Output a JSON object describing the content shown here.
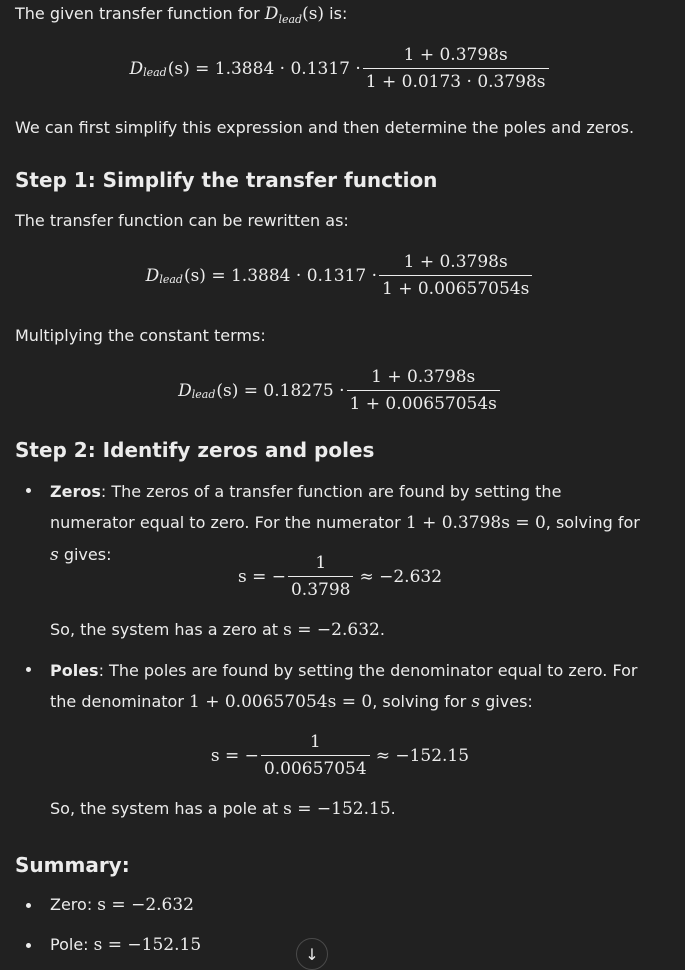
{
  "intro": {
    "text_before": "The given transfer function for ",
    "text_after": " is:",
    "D": "D",
    "sub": "lead",
    "arg": "(s)"
  },
  "eq1": {
    "lhs_D": "D",
    "lhs_sub": "lead",
    "lhs_arg": "(s) = 1.3884 · 0.1317 ·",
    "num": "1 + 0.3798s",
    "den": "1 + 0.0173 · 0.3798s"
  },
  "simplify_text": "We can first simplify this expression and then determine the poles and zeros.",
  "step1": {
    "heading": "Step 1: Simplify the transfer function",
    "text": "The transfer function can be rewritten as:",
    "eq_lhs_arg": "(s) = 1.3884 · 0.1317 ·",
    "eq_num": "1 + 0.3798s",
    "eq_den": "1 + 0.00657054s",
    "multiply_text": "Multiplying the constant terms:",
    "eq2_lhs_arg": "(s) = 0.18275 ·",
    "eq2_num": "1 + 0.3798s",
    "eq2_den": "1 + 0.00657054s"
  },
  "step2": {
    "heading": "Step 2: Identify zeros and poles",
    "zeros": {
      "label": "Zeros",
      "text1": ": The zeros of a transfer function are found by setting the numerator equal to zero. For the numerator ",
      "math1": "1 + 0.3798s = 0",
      "text2": ", solving for ",
      "s": "s",
      "text3": " gives:",
      "eq_lhs": "s = −",
      "eq_num": "1",
      "eq_den": "0.3798",
      "eq_rhs": "≈ −2.632",
      "conclusion_text": "So, the system has a zero at ",
      "conclusion_math": "s = −2.632",
      "conclusion_end": "."
    },
    "poles": {
      "label": "Poles",
      "text1": ": The poles are found by setting the denominator equal to zero. For the denominator ",
      "math1": "1 + 0.00657054s = 0",
      "text2": ", solving for ",
      "s": "s",
      "text3": " gives:",
      "eq_lhs": "s = −",
      "eq_num": "1",
      "eq_den": "0.00657054",
      "eq_rhs": "≈ −152.15",
      "conclusion_text": "So, the system has a pole at ",
      "conclusion_math": "s = −152.15",
      "conclusion_end": "."
    }
  },
  "summary": {
    "heading": "Summary:",
    "zero_label": "Zero: ",
    "zero_math": "s = −2.632",
    "pole_label": "Pole: ",
    "pole_math": "s = −152.15"
  },
  "icons": {
    "scroll_down": "↓"
  }
}
